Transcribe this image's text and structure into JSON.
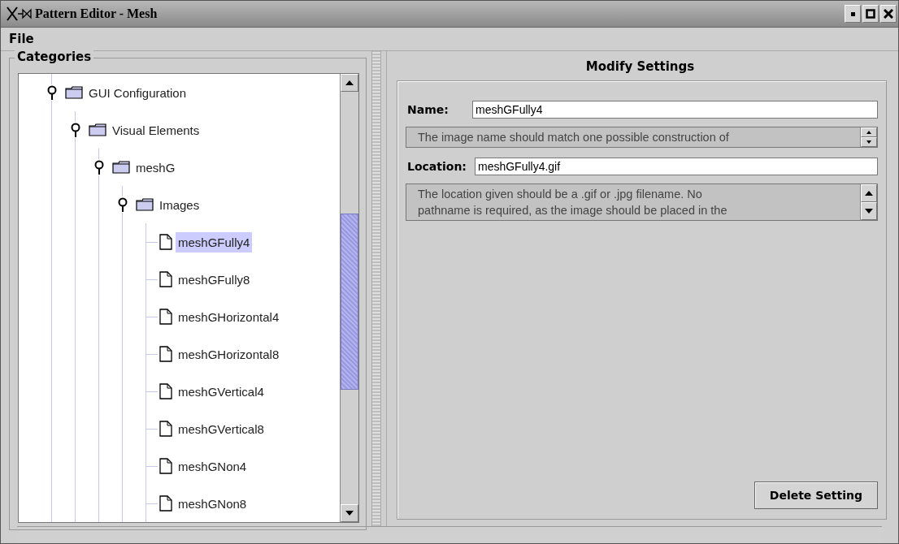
{
  "window": {
    "title": "Pattern Editor  - Mesh"
  },
  "menu": [
    "File"
  ],
  "categories": {
    "title": "Categories",
    "tree": [
      {
        "label": "GUI Configuration",
        "kind": "folder",
        "expanded": true,
        "selected": false,
        "children": [
          {
            "label": "Visual Elements",
            "kind": "folder",
            "expanded": true,
            "selected": false,
            "children": [
              {
                "label": "meshG",
                "kind": "folder",
                "expanded": true,
                "selected": false,
                "children": [
                  {
                    "label": "Images",
                    "kind": "folder",
                    "expanded": true,
                    "selected": false,
                    "children": [
                      {
                        "label": "meshGFully4",
                        "kind": "file",
                        "selected": true
                      },
                      {
                        "label": "meshGFully8",
                        "kind": "file",
                        "selected": false
                      },
                      {
                        "label": "meshGHorizontal4",
                        "kind": "file",
                        "selected": false
                      },
                      {
                        "label": "meshGHorizontal8",
                        "kind": "file",
                        "selected": false
                      },
                      {
                        "label": "meshGVertical4",
                        "kind": "file",
                        "selected": false
                      },
                      {
                        "label": "meshGVertical8",
                        "kind": "file",
                        "selected": false
                      },
                      {
                        "label": "meshGNon4",
                        "kind": "file",
                        "selected": false
                      },
                      {
                        "label": "meshGNon8",
                        "kind": "file",
                        "selected": false
                      }
                    ]
                  }
                ]
              }
            ]
          }
        ]
      }
    ]
  },
  "settings": {
    "title": "Modify Settings",
    "fields": [
      {
        "label": "Name:",
        "value": "meshGFully4",
        "help_lines": [
          "The image name should match one possible construction of"
        ],
        "kind": "spinner"
      },
      {
        "label": "Location:",
        "value": "meshGFully4.gif",
        "help_lines": [
          "The location given should be a .gif or .jpg filename.  No",
          "pathname is required, as the image should be placed in the"
        ],
        "kind": "arrows"
      }
    ],
    "button": "Delete Setting"
  }
}
